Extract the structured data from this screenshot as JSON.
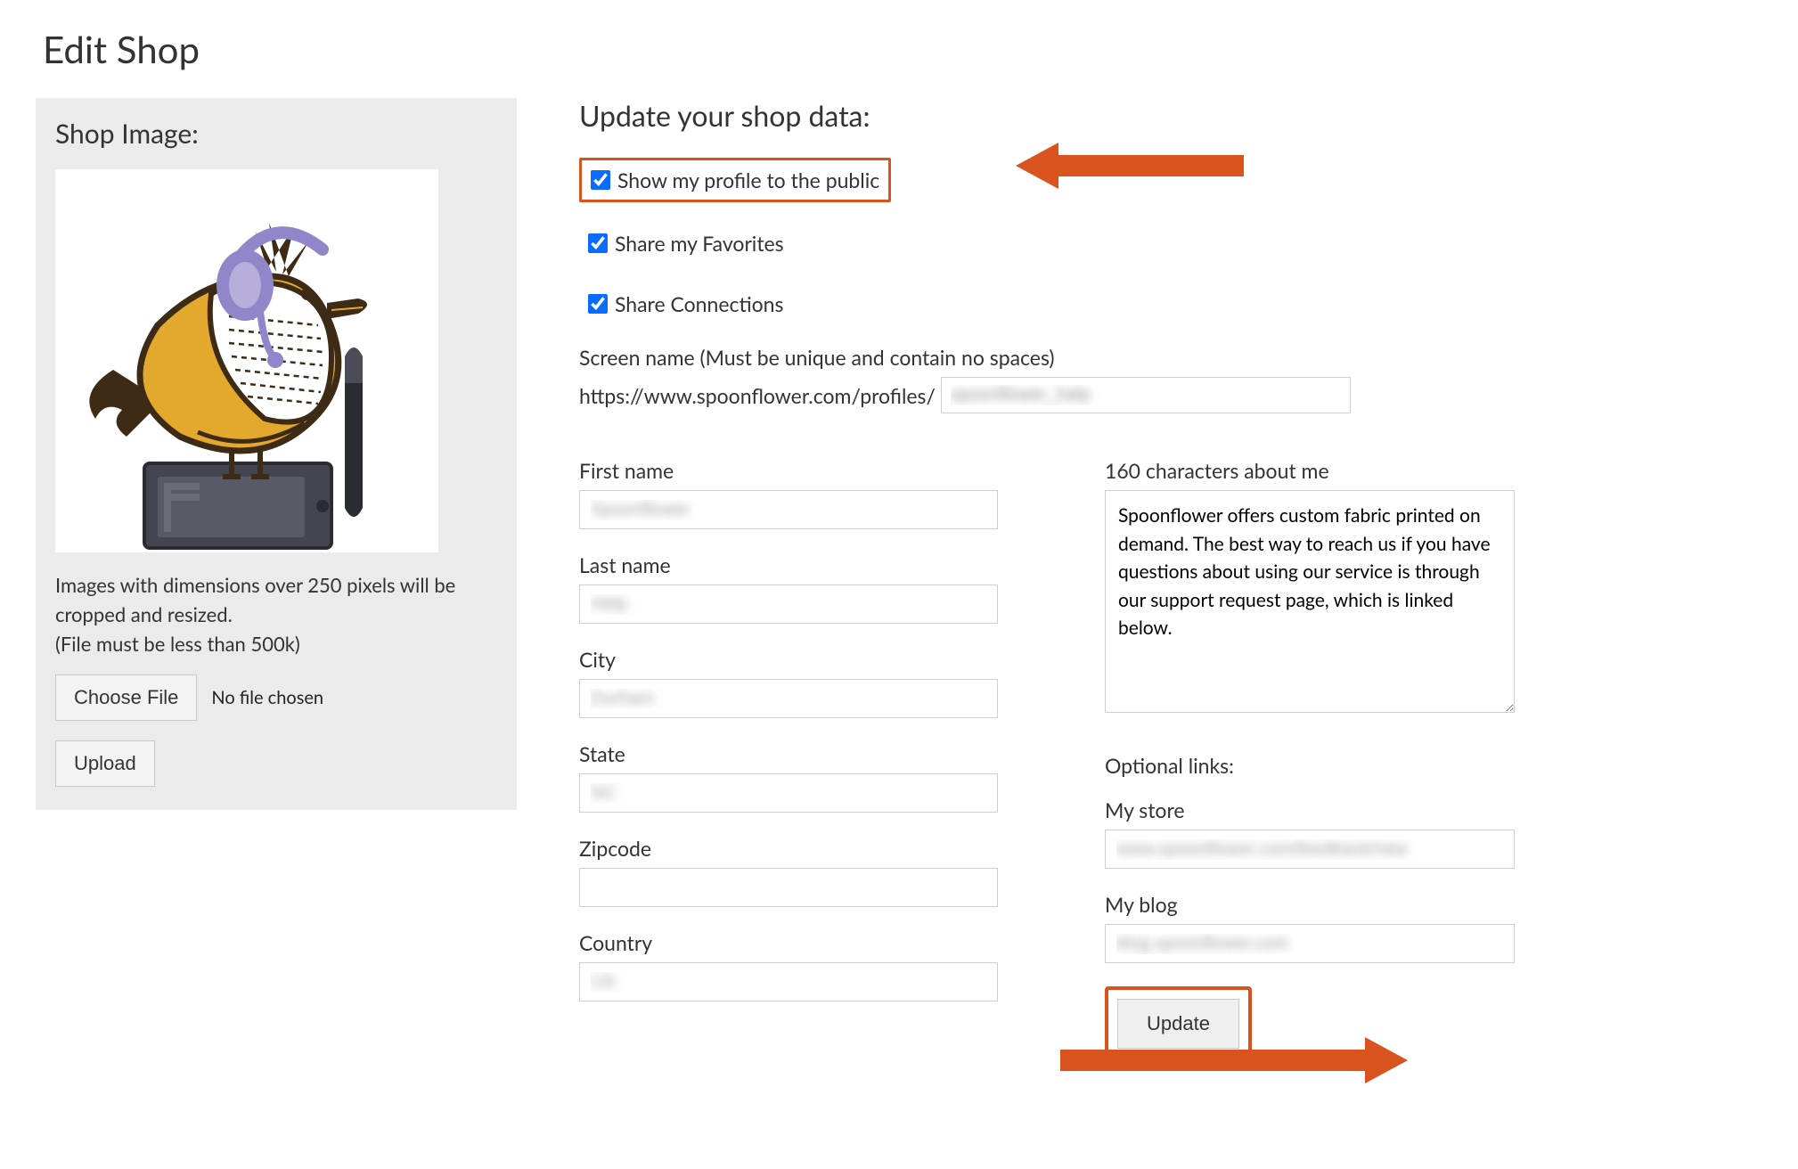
{
  "page": {
    "title": "Edit Shop"
  },
  "sidebar": {
    "heading": "Shop Image:",
    "dimensions_note": "Images with dimensions over 250 pixels will be cropped and resized.",
    "file_note": "(File must be less than 500k)",
    "choose_file_label": "Choose File",
    "no_file_text": "No file chosen",
    "upload_label": "Upload"
  },
  "form": {
    "heading": "Update your shop data:",
    "checkbox_show_public": "Show my profile to the public",
    "checkbox_share_favs": "Share my Favorites",
    "checkbox_share_conn": "Share Connections",
    "screen_name_label": "Screen name (Must be unique and contain no spaces)",
    "profile_url_prefix": "https://www.spoonflower.com/profiles/",
    "screen_name_value": "spoonflower_help",
    "fields": {
      "first_name": {
        "label": "First name",
        "value": "Spoonflower"
      },
      "last_name": {
        "label": "Last name",
        "value": "Help"
      },
      "city": {
        "label": "City",
        "value": "Durham"
      },
      "state": {
        "label": "State",
        "value": "NC"
      },
      "zipcode": {
        "label": "Zipcode",
        "value": ""
      },
      "country": {
        "label": "Country",
        "value": "US"
      }
    },
    "about": {
      "label": "160 characters about me",
      "value": "Spoonflower offers custom fabric printed on demand. The best way to reach us if you have questions about using our service is through our support request page, which is linked below."
    },
    "optional_links": {
      "heading": "Optional links:",
      "store_label": "My store",
      "store_value": "www.spoonflower.com/feedback/new",
      "blog_label": "My blog",
      "blog_value": "blog.spoonflower.com"
    },
    "update_label": "Update"
  },
  "colors": {
    "highlight": "#d9531e",
    "checkbox_accent": "#0a6cff"
  }
}
